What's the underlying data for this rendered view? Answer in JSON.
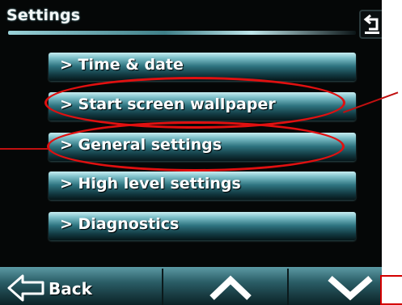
{
  "header": {
    "title": "Settings",
    "return_icon": "return-arrow-icon"
  },
  "menu": {
    "items": [
      {
        "label": "> Time & date"
      },
      {
        "label": "> Start screen wallpaper"
      },
      {
        "label": "> General settings"
      },
      {
        "label": "> High level settings"
      },
      {
        "label": "> Diagnostics"
      }
    ]
  },
  "footer": {
    "back_label": "Back",
    "back_icon": "back-arrow-icon",
    "up_icon": "chevron-up-icon",
    "down_icon": "chevron-down-icon"
  },
  "annotations": {
    "highlight_color": "#e01010"
  }
}
